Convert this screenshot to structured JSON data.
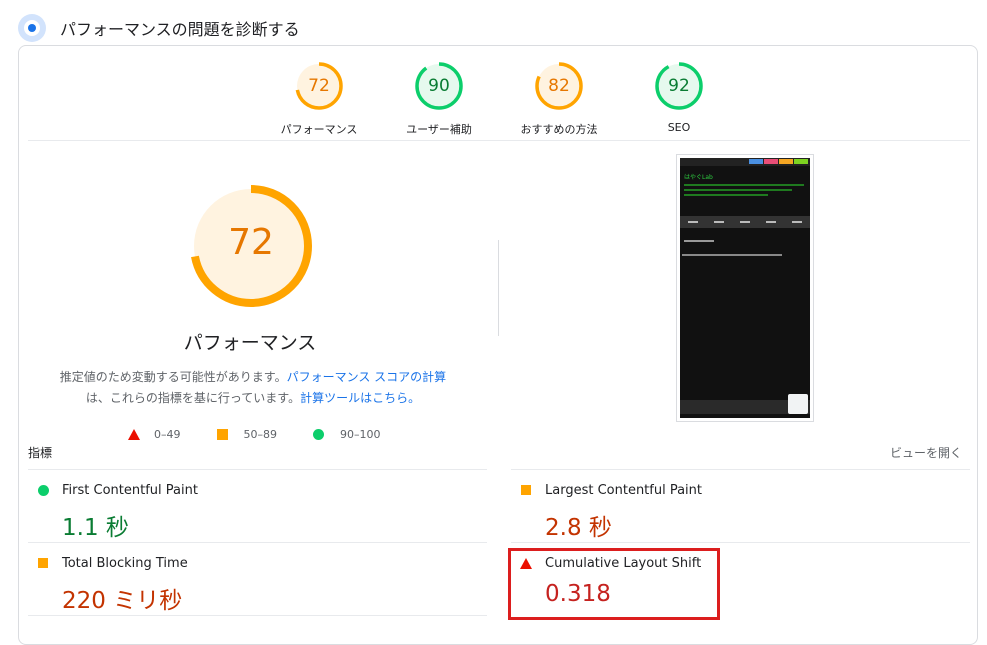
{
  "header": {
    "title": "パフォーマンスの問題を診断する"
  },
  "gauges": [
    {
      "score": "72",
      "label": "パフォーマンス",
      "fraction": 0.72,
      "color": "#ffa400",
      "text_color": "#e67700",
      "bg": "#fff3e0"
    },
    {
      "score": "90",
      "label": "ユーザー補助",
      "fraction": 0.9,
      "color": "#0cce6b",
      "text_color": "#0a7c33",
      "bg": "#e6f9ee"
    },
    {
      "score": "82",
      "label": "おすすめの方法",
      "fraction": 0.82,
      "color": "#ffa400",
      "text_color": "#e67700",
      "bg": "#fff3e0"
    },
    {
      "score": "92",
      "label": "SEO",
      "fraction": 0.92,
      "color": "#0cce6b",
      "text_color": "#0a7c33",
      "bg": "#e6f9ee"
    }
  ],
  "main_gauge": {
    "score": "72",
    "label": "パフォーマンス",
    "fraction": 0.72
  },
  "description": {
    "text1": "推定値のため変動する可能性があります。",
    "link1": "パフォーマンス スコアの計算",
    "text2": "は、これらの指標を基に行っています。",
    "link2": "計算ツールはこちら。"
  },
  "legend": {
    "fail": "0–49",
    "average": "50–89",
    "pass": "90–100"
  },
  "metrics_label": "指標",
  "view_open": "ビューを開く",
  "metrics": [
    {
      "name": "First Contentful Paint",
      "value": "1.1 秒",
      "status": "pass"
    },
    {
      "name": "Largest Contentful Paint",
      "value": "2.8 秒",
      "status": "average"
    },
    {
      "name": "Total Blocking Time",
      "value": "220 ミリ秒",
      "status": "average"
    },
    {
      "name": "Cumulative Layout Shift",
      "value": "0.318",
      "status": "fail"
    }
  ],
  "thumbnail": {
    "site_title": "はやぐLab",
    "colors": {
      "tab1": "#4a90e2",
      "tab2": "#e94e77",
      "tab3": "#f5a623",
      "tab4": "#7ed321"
    }
  },
  "colors": {
    "pass": "#0cce6b",
    "average": "#ffa400",
    "fail": "#eb0f00",
    "highlight": "#dc1e1e"
  }
}
